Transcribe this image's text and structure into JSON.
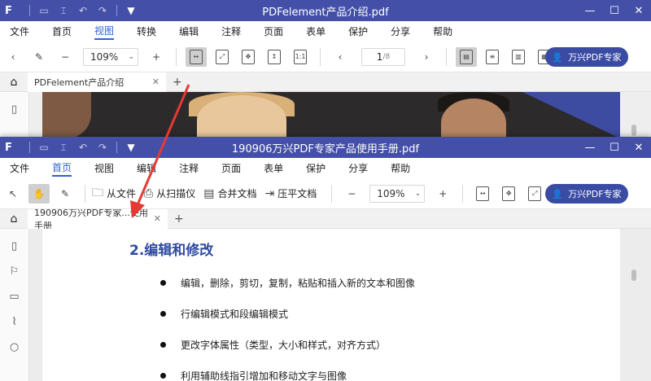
{
  "back_window": {
    "title": "PDFelement产品介绍.pdf",
    "menu": [
      "文件",
      "首页",
      "视图",
      "转换",
      "编辑",
      "注释",
      "页面",
      "表单",
      "保护",
      "分享",
      "帮助"
    ],
    "active_menu": "视图",
    "zoom": "109%",
    "page_current": "1",
    "page_total": "/8",
    "brand_button": "万兴PDF专家",
    "tab_label": "PDFelement产品介绍"
  },
  "front_window": {
    "title": "190906万兴PDF专家产品使用手册.pdf",
    "menu": [
      "文件",
      "首页",
      "视图",
      "编辑",
      "注释",
      "页面",
      "表单",
      "保护",
      "分享",
      "帮助"
    ],
    "active_menu": "首页",
    "tools": {
      "from_file": "从文件",
      "from_scanner": "从扫描仪",
      "merge": "合并文档",
      "flatten": "压平文档"
    },
    "zoom": "109%",
    "brand_button": "万兴PDF专家",
    "tab_label": "190906万兴PDF专家...使用手册"
  },
  "document": {
    "heading": "2.编辑和修改",
    "bullets": [
      "编辑，删除，剪切，复制，粘贴和插入新的文本和图像",
      "行编辑模式和段编辑模式",
      "更改字体属性（类型，大小和样式，对齐方式）",
      "利用辅助线指引增加和移动文字与图像"
    ]
  },
  "colors": {
    "titlebar": "#4450a8",
    "accent": "#2f62d8",
    "brand_button": "#3a4ba3",
    "heading": "#2f4aa0",
    "arrow": "#e53935"
  }
}
